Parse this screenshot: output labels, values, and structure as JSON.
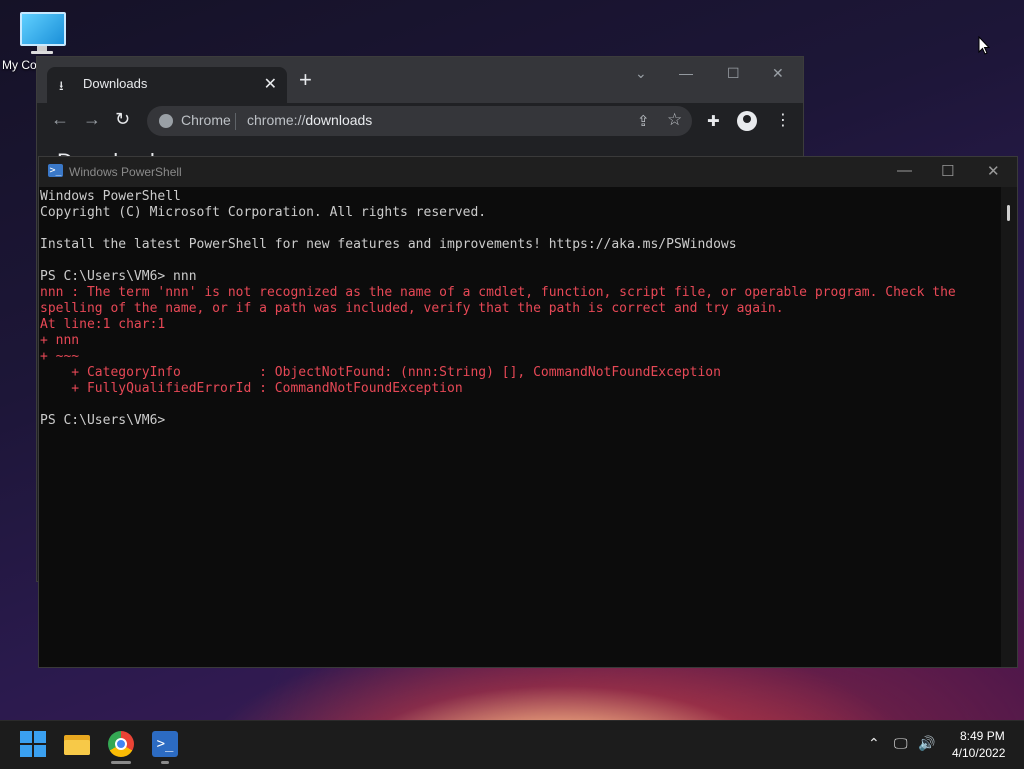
{
  "desktop": {
    "icon_label": "My Co"
  },
  "chrome": {
    "tab_title": "Downloads",
    "tab_close": "✕",
    "new_tab": "+",
    "omnibox_site_label": "Chrome",
    "omnibox_url_scheme": "chrome://",
    "omnibox_url_host": "downloads",
    "page_heading": "Downloads"
  },
  "powershell": {
    "title": "Windows PowerShell",
    "lines": [
      {
        "text": "Windows PowerShell",
        "type": "normal"
      },
      {
        "text": "Copyright (C) Microsoft Corporation. All rights reserved.",
        "type": "normal"
      },
      {
        "text": "",
        "type": "normal"
      },
      {
        "text": "Install the latest PowerShell for new features and improvements! https://aka.ms/PSWindows",
        "type": "normal"
      },
      {
        "text": "",
        "type": "normal"
      },
      {
        "text": "PS C:\\Users\\VM6> nnn",
        "type": "normal"
      },
      {
        "text": "nnn : The term 'nnn' is not recognized as the name of a cmdlet, function, script file, or operable program. Check the",
        "type": "error"
      },
      {
        "text": "spelling of the name, or if a path was included, verify that the path is correct and try again.",
        "type": "error"
      },
      {
        "text": "At line:1 char:1",
        "type": "error"
      },
      {
        "text": "+ nnn",
        "type": "error"
      },
      {
        "text": "+ ~~~",
        "type": "error"
      },
      {
        "text": "    + CategoryInfo          : ObjectNotFound: (nnn:String) [], CommandNotFoundException",
        "type": "error"
      },
      {
        "text": "    + FullyQualifiedErrorId : CommandNotFoundException",
        "type": "error"
      },
      {
        "text": "",
        "type": "normal"
      },
      {
        "text": "PS C:\\Users\\VM6>",
        "type": "normal"
      }
    ]
  },
  "taskbar": {
    "time": "8:49 PM",
    "date": "4/10/2022",
    "apps": [
      "start-icon",
      "file-explorer-icon",
      "chrome-icon",
      "powershell-icon"
    ]
  },
  "colors": {
    "terminal_bg": "#0c0c0c",
    "terminal_text": "#cccccc",
    "error_text": "#e74856",
    "chrome_bg": "#202124"
  }
}
